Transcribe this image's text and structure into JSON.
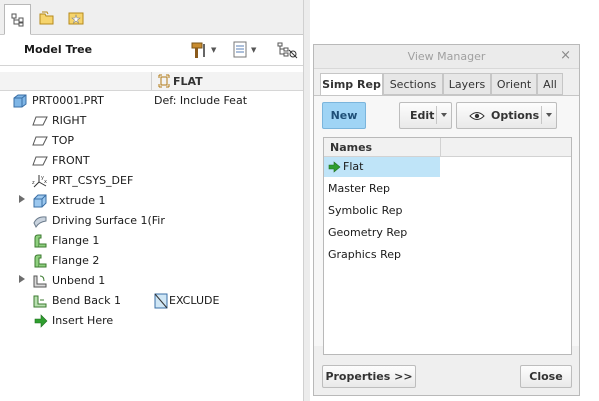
{
  "left_panel": {
    "tabs": [
      "model-tree-tab",
      "folder-browser-tab",
      "favorites-tab"
    ],
    "toolbar": {
      "title": "Model Tree"
    },
    "columns": {
      "flat_label": "FLAT"
    },
    "rows": [
      {
        "label": "PRT0001.PRT",
        "value": "Def: Include Feat",
        "icon": "part-icon",
        "expandable": false
      },
      {
        "label": "RIGHT",
        "value": "",
        "icon": "datum-plane-icon",
        "expandable": false
      },
      {
        "label": "TOP",
        "value": "",
        "icon": "datum-plane-icon",
        "expandable": false
      },
      {
        "label": "FRONT",
        "value": "",
        "icon": "datum-plane-icon",
        "expandable": false
      },
      {
        "label": "PRT_CSYS_DEF",
        "value": "",
        "icon": "csys-icon",
        "expandable": false
      },
      {
        "label": "Extrude 1",
        "value": "",
        "icon": "extrude-icon",
        "expandable": true
      },
      {
        "label": "Driving Surface 1(Fir",
        "value": "",
        "icon": "surface-icon",
        "expandable": false
      },
      {
        "label": "Flange 1",
        "value": "",
        "icon": "flange-icon",
        "expandable": false
      },
      {
        "label": "Flange 2",
        "value": "",
        "icon": "flange-icon",
        "expandable": false
      },
      {
        "label": "Unbend 1",
        "value": "",
        "icon": "unbend-icon",
        "expandable": true
      },
      {
        "label": "Bend Back 1",
        "value": "EXCLUDE",
        "icon": "bend-back-icon",
        "expandable": false
      },
      {
        "label": "Insert Here",
        "value": "",
        "icon": "insert-arrow-icon",
        "expandable": false
      }
    ]
  },
  "view_manager": {
    "title": "View Manager",
    "close": "×",
    "tabs": [
      "Simp Rep",
      "Sections",
      "Layers",
      "Orient",
      "All"
    ],
    "active_tab": "Simp Rep",
    "buttons": {
      "new": "New",
      "edit": "Edit",
      "options": "Options",
      "properties": "Properties >>",
      "close": "Close"
    },
    "names_header": "Names",
    "reps": [
      "Flat",
      "Master Rep",
      "Symbolic Rep",
      "Geometry Rep",
      "Graphics Rep"
    ],
    "selected_rep": "Flat"
  },
  "colors": {
    "accent_blue": "#9fd4f5",
    "selection": "#bfe4f8",
    "green_arrow": "#2f9e2f"
  }
}
